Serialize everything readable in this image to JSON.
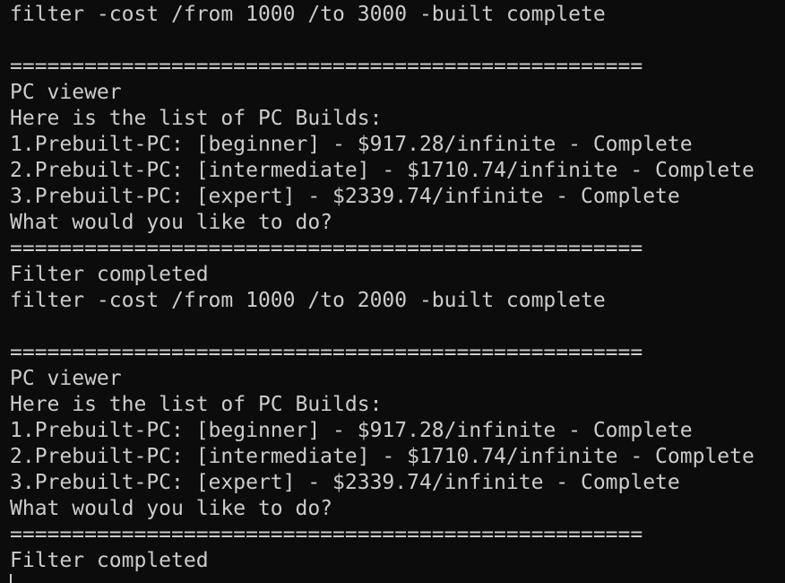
{
  "terminal": {
    "lines": [
      "filter -cost /from 1000 /to 3000 -built complete",
      "",
      "===================================================",
      "PC viewer",
      "Here is the list of PC Builds:",
      "1.Prebuilt-PC: [beginner] - $917.28/infinite - Complete",
      "2.Prebuilt-PC: [intermediate] - $1710.74/infinite - Complete",
      "3.Prebuilt-PC: [expert] - $2339.74/infinite - Complete",
      "What would you like to do?",
      "===================================================",
      "Filter completed",
      "filter -cost /from 1000 /to 2000 -built complete",
      "",
      "===================================================",
      "PC viewer",
      "Here is the list of PC Builds:",
      "1.Prebuilt-PC: [beginner] - $917.28/infinite - Complete",
      "2.Prebuilt-PC: [intermediate] - $1710.74/infinite - Complete",
      "3.Prebuilt-PC: [expert] - $2339.74/infinite - Complete",
      "What would you like to do?",
      "===================================================",
      "Filter completed"
    ]
  }
}
